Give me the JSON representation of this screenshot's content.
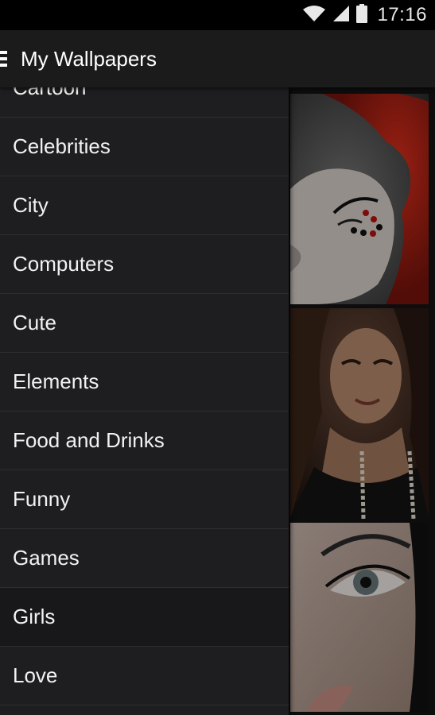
{
  "status_bar": {
    "time": "17:16",
    "icons": [
      "wifi-icon",
      "cell-signal-icon",
      "battery-icon"
    ]
  },
  "action_bar": {
    "title": "My Wallpapers",
    "nav_icon": "hamburger-icon"
  },
  "drawer": {
    "items": [
      {
        "label": "Cartoon"
      },
      {
        "label": "Celebrities"
      },
      {
        "label": "City"
      },
      {
        "label": "Computers"
      },
      {
        "label": "Cute"
      },
      {
        "label": "Elements"
      },
      {
        "label": "Food and Drinks"
      },
      {
        "label": "Funny"
      },
      {
        "label": "Games"
      },
      {
        "label": "Girls",
        "selected": true
      },
      {
        "label": "Love"
      }
    ]
  },
  "gallery": {
    "thumbnails": [
      "red-hair-face-paint",
      "brunette-portrait",
      "eye-close-up"
    ]
  },
  "colors": {
    "background": "#000000",
    "action_bar": "#1b1b1b",
    "drawer": "#1e1e20",
    "divider": "#2e2e31",
    "text": "#f2f2f2"
  }
}
